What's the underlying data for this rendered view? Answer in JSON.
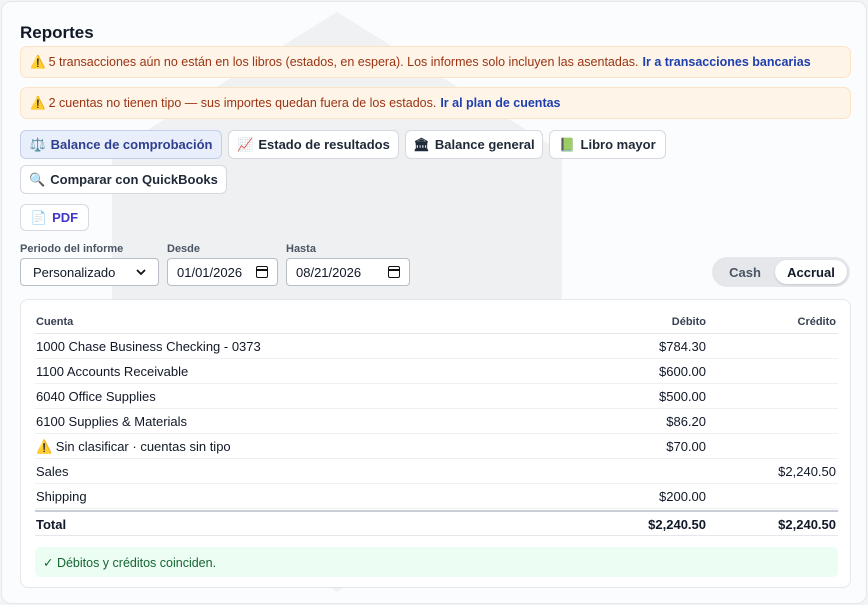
{
  "page": {
    "title": "Reportes"
  },
  "alerts": [
    {
      "icon": "warning-icon",
      "emoji": "⚠️",
      "text": "5 transacciones aún no están en los libros (estados, en espera). Los informes solo incluyen las asentadas.",
      "link": "Ir a transacciones bancarias"
    },
    {
      "icon": "warning-icon",
      "emoji": "⚠️",
      "text": "2 cuentas no tienen tipo — sus importes quedan fuera de los estados.",
      "link": "Ir al plan de cuentas"
    }
  ],
  "report_tabs": [
    {
      "emoji": "⚖️",
      "icon": "balance-scale-icon",
      "label": "Balance de comprobación",
      "active": true
    },
    {
      "emoji": "📈",
      "icon": "chart-up-icon",
      "label": "Estado de resultados",
      "active": false
    },
    {
      "emoji": "🏛",
      "icon": "bank-icon",
      "label": "Balance general",
      "active": false
    },
    {
      "emoji": "📗",
      "icon": "green-book-icon",
      "label": "Libro mayor",
      "active": false
    },
    {
      "emoji": "🔍",
      "icon": "magnifier-icon",
      "label": "Comparar con QuickBooks",
      "active": false
    }
  ],
  "pdf_button": {
    "emoji": "📄",
    "label": "PDF"
  },
  "filters": {
    "period_label": "Periodo del informe",
    "period_value": "Personalizado",
    "from_label": "Desde",
    "from_value": "01/01/2026",
    "to_label": "Hasta",
    "to_value": "08/21/2026"
  },
  "basis_toggle": {
    "cash": "Cash",
    "accrual": "Accrual",
    "selected": "Accrual"
  },
  "table": {
    "headers": {
      "account": "Cuenta",
      "debit": "Débito",
      "credit": "Crédito"
    },
    "rows": [
      {
        "account": "1000 Chase Business Checking - 0373",
        "debit": "$784.30",
        "credit": ""
      },
      {
        "account": "1100 Accounts Receivable",
        "debit": "$600.00",
        "credit": ""
      },
      {
        "account": "6040 Office Supplies",
        "debit": "$500.00",
        "credit": ""
      },
      {
        "account": "6100 Supplies & Materials",
        "debit": "$86.20",
        "credit": ""
      },
      {
        "account": "⚠️ Sin clasificar · cuentas sin tipo",
        "debit": "$70.00",
        "credit": ""
      },
      {
        "account": "Sales",
        "debit": "",
        "credit": "$2,240.50"
      },
      {
        "account": "Shipping",
        "debit": "$200.00",
        "credit": ""
      }
    ],
    "total": {
      "account": "Total",
      "debit": "$2,240.50",
      "credit": "$2,240.50"
    },
    "balanced_message": "✓ Débitos y créditos coinciden."
  },
  "colors": {
    "accent": "#2e3f8f",
    "warning_bg": "#fff4e8",
    "warning_text": "#9a3412",
    "success_bg": "#ecfdf3",
    "success_text": "#166534"
  }
}
